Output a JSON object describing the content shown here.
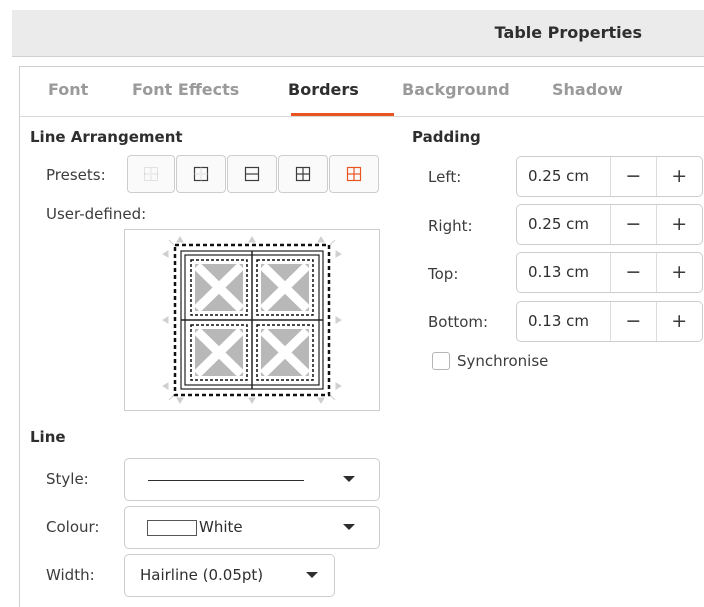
{
  "window": {
    "title": "Table Properties"
  },
  "tabs": [
    {
      "label": "Font",
      "active": false
    },
    {
      "label": "Font Effects",
      "active": false
    },
    {
      "label": "Borders",
      "active": true
    },
    {
      "label": "Background",
      "active": false
    },
    {
      "label": "Shadow",
      "active": false
    }
  ],
  "colors": {
    "accent": "#e95420",
    "preset_highlight": "#e95420"
  },
  "line_arrangement": {
    "heading": "Line Arrangement",
    "presets_label": "Presets:",
    "presets": [
      {
        "icon": "no-borders-icon"
      },
      {
        "icon": "outer-border-only-icon"
      },
      {
        "icon": "outer-border-horizontal-lines-icon"
      },
      {
        "icon": "outer-border-all-inner-lines-icon"
      },
      {
        "icon": "outer-border-keep-inner-icon"
      }
    ],
    "user_defined_label": "User-defined:"
  },
  "padding": {
    "heading": "Padding",
    "left": {
      "label": "Left:",
      "value": "0.25 cm"
    },
    "right": {
      "label": "Right:",
      "value": "0.25 cm"
    },
    "top": {
      "label": "Top:",
      "value": "0.13 cm"
    },
    "bottom": {
      "label": "Bottom:",
      "value": "0.13 cm"
    },
    "minus": "−",
    "plus": "+",
    "synchronise_label": "Synchronise",
    "synchronise_checked": false
  },
  "line": {
    "heading": "Line",
    "style_label": "Style:",
    "colour_label": "Colour:",
    "colour_value": "White",
    "colour_swatch": "#ffffff",
    "width_label": "Width:",
    "width_value": "Hairline (0.05pt)"
  }
}
